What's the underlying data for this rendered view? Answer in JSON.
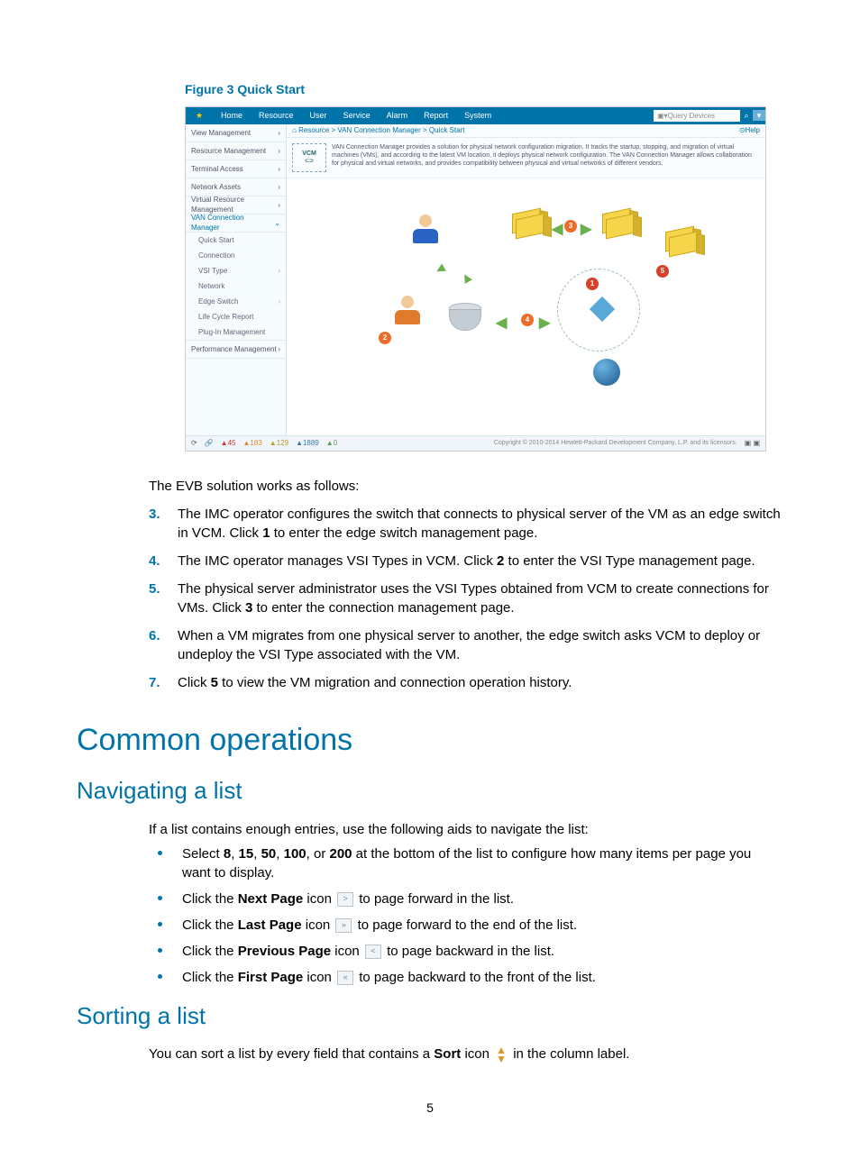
{
  "figure_caption": "Figure 3 Quick Start",
  "screenshot": {
    "topnav": [
      "Home",
      "Resource",
      "User",
      "Service",
      "Alarm",
      "Report",
      "System"
    ],
    "search_placeholder": "Query Devices",
    "sidebar": {
      "items": [
        {
          "label": "View Management"
        },
        {
          "label": "Resource Management"
        },
        {
          "label": "Terminal Access"
        },
        {
          "label": "Network Assets"
        },
        {
          "label": "Virtual Resource Management"
        },
        {
          "label": "VAN Connection Manager",
          "active": true
        }
      ],
      "subitems": [
        {
          "label": "Quick Start"
        },
        {
          "label": "Connection"
        },
        {
          "label": "VSI Type",
          "chevron": true
        },
        {
          "label": "Network"
        },
        {
          "label": "Edge Switch",
          "chevron": true
        },
        {
          "label": "Life Cycle Report"
        },
        {
          "label": "Plug-In Management"
        }
      ],
      "footer_item": "Performance Management"
    },
    "breadcrumb": "Resource > VAN Connection Manager > Quick Start",
    "help_label": "Help",
    "vcm_label": "VCM",
    "description": "VAN Connection Manager provides a solution for physical network configuration migration. It tracks the startup, stopping, and migration of virtual machines (VMs), and according to the latest VM location, it deploys physical network configuration. The VAN Connection Manager allows collaboration for physical and virtual networks, and provides compatibility between physical and virtual networks of different vendors.",
    "badges": {
      "b1": "1",
      "b2": "2",
      "b3": "3",
      "b4": "4",
      "b5": "5"
    },
    "statusbar": {
      "s1": "45",
      "s2": "183",
      "s3": "129",
      "s4": "1889",
      "s5": "0",
      "copyright": "Copyright © 2010-2014 Hewlett-Packard Development Company, L.P. and its licensors."
    }
  },
  "intro": "The EVB solution works as follows:",
  "steps": [
    {
      "n": "3.",
      "pre": "The IMC operator configures the switch that connects to physical server of the VM as an edge switch in VCM. Click ",
      "bold": "1",
      "post": " to enter the edge switch management page."
    },
    {
      "n": "4.",
      "pre": "The IMC operator manages VSI Types in VCM. Click ",
      "bold": "2",
      "post": " to enter the VSI Type management page."
    },
    {
      "n": "5.",
      "pre": "The physical server administrator uses the VSI Types obtained from VCM to create connections for VMs. Click ",
      "bold": "3",
      "post": " to enter the connection management page."
    },
    {
      "n": "6.",
      "pre": "When a VM migrates from one physical server to another, the edge switch asks VCM to deploy or undeploy the VSI Type associated with the VM.",
      "bold": "",
      "post": ""
    },
    {
      "n": "7.",
      "pre": "Click ",
      "bold": "5",
      "post": " to view the VM migration and connection operation history."
    }
  ],
  "h1": "Common operations",
  "nav_heading": "Navigating a list",
  "nav_intro": "If a list contains enough entries, use the following aids to navigate the list:",
  "nav_bullets": [
    {
      "pre": "Select ",
      "b": "8",
      "mid": ", ",
      "b2": "15",
      "mid2": ", ",
      "b3": "50",
      "mid3": ", ",
      "b4": "100",
      "mid4": ", or ",
      "b5": "200",
      "post": " at the bottom of the list to configure how many items per page you want to display.",
      "icon": ""
    },
    {
      "pre": "Click the ",
      "b": "Next Page",
      "mid": " icon ",
      "icon": ">",
      "post": " to page forward in the list."
    },
    {
      "pre": "Click the ",
      "b": "Last Page",
      "mid": " icon ",
      "icon": "»",
      "post": " to page forward to the end of the list."
    },
    {
      "pre": "Click the ",
      "b": "Previous Page",
      "mid": " icon ",
      "icon": "<",
      "post": " to page backward in the list."
    },
    {
      "pre": "Click the ",
      "b": "First Page",
      "mid": " icon ",
      "icon": "«",
      "post": " to page backward to the front of the list."
    }
  ],
  "sort_heading": "Sorting a list",
  "sort_text_pre": "You can sort a list by every field that contains a ",
  "sort_bold": "Sort",
  "sort_text_mid": " icon ",
  "sort_text_post": " in the column label.",
  "page_number": "5"
}
